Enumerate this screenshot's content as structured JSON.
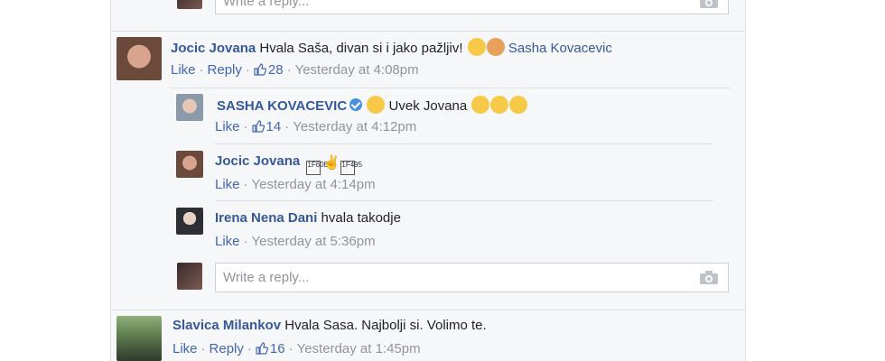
{
  "top_reply": {
    "placeholder": "Write a reply..."
  },
  "comments": [
    {
      "author": "Jocic Jovana",
      "text": "Hvala Saša, divan si i jako pažljiv!",
      "emoji": [
        "heart-eyes-emoji",
        "couple-emoji"
      ],
      "tag": "Sasha Kovacevic",
      "like_label": "Like",
      "reply_label": "Reply",
      "like_count": "28",
      "time": "Yesterday at 4:08pm",
      "replies": [
        {
          "author": "SASHA KOVACEVIC",
          "verified": true,
          "text": "Uvek Jovana",
          "emoji_before": "smirk-emoji",
          "emoji_after": [
            "relieved-emoji",
            "heart-eyes-emoji",
            "tongue-emoji"
          ],
          "like_label": "Like",
          "like_count": "14",
          "time": "Yesterday at 4:12pm"
        },
        {
          "author": "Jocic Jovana",
          "glyphs": [
            "1F60B",
            "270C",
            "1F495"
          ],
          "like_label": "Like",
          "time": "Yesterday at 4:14pm"
        },
        {
          "author": "Irena Nena Dani",
          "text": "hvala takodje",
          "like_label": "Like",
          "time": "Yesterday at 5:36pm"
        }
      ],
      "reply_placeholder": "Write a reply..."
    },
    {
      "author": "Slavica Milankov",
      "text": "Hvala Sasa. Najbolji si. Volimo te.",
      "like_label": "Like",
      "reply_label": "Reply",
      "like_count": "16",
      "time": "Yesterday at 1:45pm"
    }
  ],
  "colors": {
    "link": "#365899",
    "action": "#4267b2",
    "meta": "#90949c",
    "emoji": "#f7c948"
  }
}
